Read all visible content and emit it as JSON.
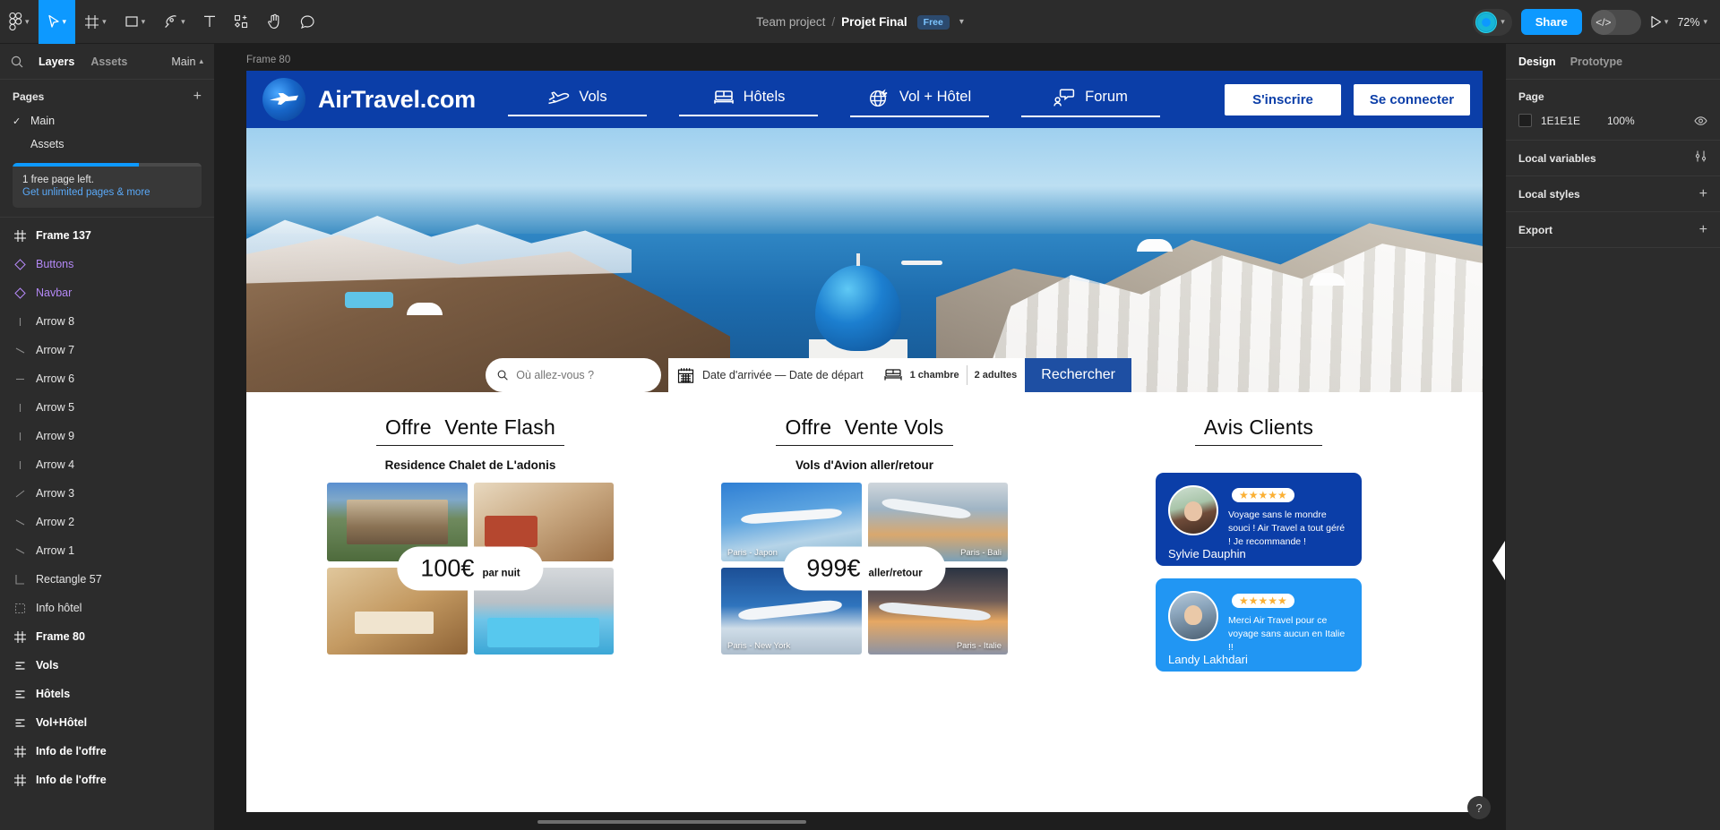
{
  "toolbar": {
    "tools": [
      {
        "name": "figma-menu-icon",
        "caret": true
      },
      {
        "name": "move-tool-icon",
        "caret": true
      },
      {
        "name": "frame-tool-icon",
        "caret": true
      },
      {
        "name": "shape-tool-icon",
        "caret": true
      },
      {
        "name": "pen-tool-icon",
        "caret": true
      },
      {
        "name": "text-tool-icon",
        "caret": false
      },
      {
        "name": "actions-tool-icon",
        "caret": false
      },
      {
        "name": "hand-tool-icon",
        "caret": false
      },
      {
        "name": "comment-tool-icon",
        "caret": false
      }
    ],
    "breadcrumb_team": "Team project",
    "breadcrumb_sep": "/",
    "breadcrumb_file": "Projet Final",
    "plan_badge": "Free",
    "share_label": "Share",
    "dev_mode_icon": "</>",
    "zoom_level": "72%"
  },
  "left_panel": {
    "tab_layers": "Layers",
    "tab_assets": "Assets",
    "branch_label": "Main",
    "pages_title": "Pages",
    "pages": [
      {
        "label": "Main",
        "selected": true
      },
      {
        "label": "Assets",
        "selected": false
      }
    ],
    "promo_line1": "1 free page left.",
    "promo_line2": "Get unlimited pages & more",
    "layers": [
      {
        "label": "Frame 137",
        "type": "frame",
        "style": "bold"
      },
      {
        "label": "Buttons",
        "type": "component",
        "style": "comp"
      },
      {
        "label": "Navbar",
        "type": "component",
        "style": "comp"
      },
      {
        "label": "Arrow 8",
        "type": "line-v",
        "style": "normal"
      },
      {
        "label": "Arrow 7",
        "type": "line-dd",
        "style": "normal"
      },
      {
        "label": "Arrow 6",
        "type": "line-h",
        "style": "normal"
      },
      {
        "label": "Arrow 5",
        "type": "line-v",
        "style": "normal"
      },
      {
        "label": "Arrow 9",
        "type": "line-v",
        "style": "normal"
      },
      {
        "label": "Arrow 4",
        "type": "line-v",
        "style": "normal"
      },
      {
        "label": "Arrow 3",
        "type": "line-du",
        "style": "normal"
      },
      {
        "label": "Arrow 2",
        "type": "line-dd",
        "style": "normal"
      },
      {
        "label": "Arrow 1",
        "type": "line-dd",
        "style": "normal"
      },
      {
        "label": "Rectangle 57",
        "type": "rect",
        "style": "normal"
      },
      {
        "label": "Info hôtel",
        "type": "group",
        "style": "normal"
      },
      {
        "label": "Frame 80",
        "type": "frame",
        "style": "bold"
      },
      {
        "label": "Vols",
        "type": "autolayout",
        "style": "bold"
      },
      {
        "label": "Hôtels",
        "type": "autolayout",
        "style": "bold"
      },
      {
        "label": "Vol+Hôtel",
        "type": "autolayout",
        "style": "bold"
      },
      {
        "label": "Info de l'offre",
        "type": "frame",
        "style": "bold"
      },
      {
        "label": "Info de l'offre",
        "type": "frame",
        "style": "bold"
      }
    ]
  },
  "right_panel": {
    "tab_design": "Design",
    "tab_prototype": "Prototype",
    "page_section_title": "Page",
    "page_color_hex": "1E1E1E",
    "page_color_opacity": "100%",
    "local_variables_label": "Local variables",
    "local_styles_label": "Local styles",
    "export_label": "Export"
  },
  "canvas": {
    "frame_label": "Frame 80",
    "site": {
      "logo_text": "AirTravel.com",
      "nav_items": [
        {
          "label": "Vols",
          "icon": "plane-icon"
        },
        {
          "label": "Hôtels",
          "icon": "bed-icon"
        },
        {
          "label": "Vol + Hôtel",
          "icon": "globe-plane-icon"
        },
        {
          "label": "Forum",
          "icon": "chat-user-icon"
        }
      ],
      "signup_label": "S'inscrire",
      "login_label": "Se connecter",
      "search": {
        "destination_placeholder": "Où allez-vous ?",
        "destination_value": "",
        "dates_label": "Date d'arrivée — Date de départ",
        "rooms_label": "1 chambre",
        "guests_label": "2 adultes",
        "button_label": "Rechercher"
      },
      "columns": [
        {
          "title_1": "Offre",
          "title_2": "Vente Flash",
          "subtitle": "Residence Chalet de L'adonis",
          "price_main": "100€",
          "price_sub": "par nuit",
          "images": [
            {
              "caption": "",
              "fill": "ph-chalet"
            },
            {
              "caption": "",
              "fill": "ph-living"
            },
            {
              "caption": "",
              "fill": "ph-wood"
            },
            {
              "caption": "",
              "fill": "ph-pool"
            }
          ]
        },
        {
          "title_1": "Offre",
          "title_2": "Vente Vols",
          "subtitle": "Vols d'Avion aller/retour",
          "price_main": "999€",
          "price_sub": "aller/retour",
          "images": [
            {
              "caption": "Paris - Japon",
              "fill": "ph-plane1",
              "side": "l"
            },
            {
              "caption": "Paris - Bali",
              "fill": "ph-plane2",
              "side": "r"
            },
            {
              "caption": "Paris - New York",
              "fill": "ph-plane3",
              "side": "l"
            },
            {
              "caption": "Paris - Italie",
              "fill": "ph-plane4",
              "side": "r"
            }
          ]
        }
      ],
      "reviews_title": "Avis Clients",
      "reviews": [
        {
          "stars": "★★★★★",
          "text": "Voyage sans le mondre souci ! Air Travel a tout géré ! Je recommande !",
          "name": "Sylvie Dauphin",
          "card_color": "#0b3ea8",
          "avatar": "female"
        },
        {
          "stars": "★★★★★",
          "text": "Merci Air Travel pour ce voyage sans aucun en Italie !!",
          "name": "Landy Lakhdari",
          "card_color": "#2196f3",
          "avatar": "male"
        }
      ]
    }
  },
  "help_button_label": "?"
}
